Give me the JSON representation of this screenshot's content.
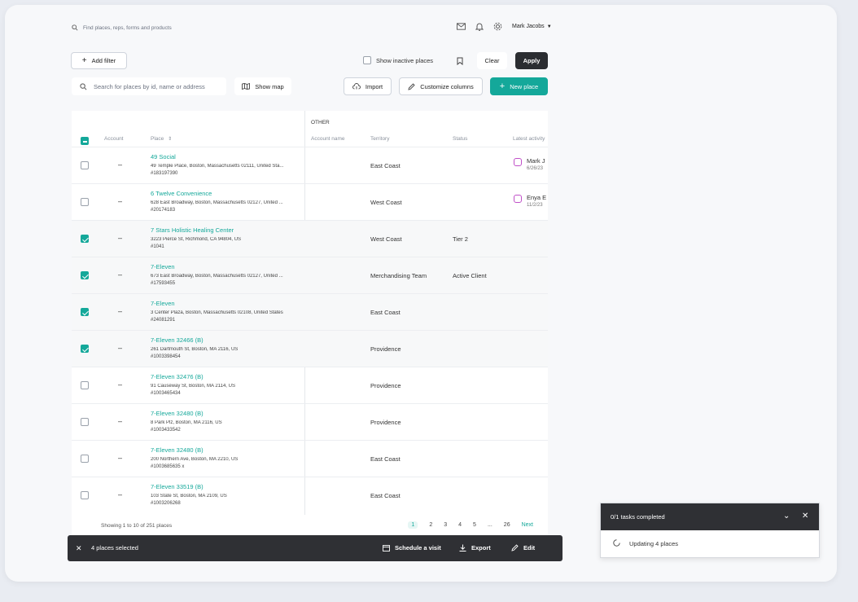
{
  "top": {
    "search_placeholder": "Find places, reps, forms and products",
    "user_name": "Mark Jacobs"
  },
  "filters": {
    "add_filter": "Add filter",
    "show_inactive": "Show inactive places",
    "clear": "Clear",
    "apply": "Apply"
  },
  "toolbar": {
    "search_placeholder": "Search for places by id, name or address",
    "show_map": "Show map",
    "import": "Import",
    "customize_columns": "Customize columns",
    "new_place": "New place"
  },
  "table": {
    "group_header": "OTHER",
    "headers": {
      "account": "Account",
      "place": "Place",
      "account_name": "Account name",
      "territory": "Territory",
      "status": "Status",
      "latest_activity": "Latest activity"
    },
    "rows": [
      {
        "selected": false,
        "account": "–",
        "name": "49 Social",
        "address": "49 Temple Place, Boston, Massachusetts 02111, United Sta...",
        "id": "#183197390",
        "territory": "East Coast",
        "status": "",
        "activity_name": "Mark J",
        "activity_date": "6/26/23"
      },
      {
        "selected": false,
        "account": "–",
        "name": "6 Twelve Convenience",
        "address": "628 East Broadway, Boston, Massachusetts 02127, United ...",
        "id": "#20174183",
        "territory": "West Coast",
        "status": "",
        "activity_name": "Enya E",
        "activity_date": "11/2/23"
      },
      {
        "selected": true,
        "account": "–",
        "name": "7 Stars Holistic Healing Center",
        "address": "3223 Pierce St, Richmond, CA 94804, US",
        "id": "#1041",
        "territory": "West Coast",
        "status": "Tier 2",
        "activity_name": "",
        "activity_date": ""
      },
      {
        "selected": true,
        "account": "–",
        "name": "7-Eleven",
        "address": "673 East Broadway, Boston, Massachusetts 02127, United ...",
        "id": "#17593455",
        "territory": "Merchandising Team",
        "status": "Active Client",
        "activity_name": "",
        "activity_date": ""
      },
      {
        "selected": true,
        "account": "–",
        "name": "7-Eleven",
        "address": "3 Center Plaza, Boston, Massachusetts 02108, United States",
        "id": "#24081291",
        "territory": "East Coast",
        "status": "",
        "activity_name": "",
        "activity_date": ""
      },
      {
        "selected": true,
        "account": "–",
        "name": "7-Eleven 32466 (B)",
        "address": "261 Dartmouth St, Boston, MA 2116, US",
        "id": "#1003398454",
        "territory": "Providence",
        "status": "",
        "activity_name": "",
        "activity_date": ""
      },
      {
        "selected": false,
        "account": "–",
        "name": "7-Eleven 32476 (B)",
        "address": "91 Causeway St, Boston, MA 2114, US",
        "id": "#1003465434",
        "territory": "Providence",
        "status": "",
        "activity_name": "",
        "activity_date": ""
      },
      {
        "selected": false,
        "account": "–",
        "name": "7-Eleven 32480 (B)",
        "address": "8 Park Plz, Boston, MA 2116, US",
        "id": "#1003433542",
        "territory": "Providence",
        "status": "",
        "activity_name": "",
        "activity_date": ""
      },
      {
        "selected": false,
        "account": "–",
        "name": "7-Eleven 32480 (B)",
        "address": "200 Northern Ave, Boston, MA 2210, US",
        "id": "#1003685635 x",
        "territory": "East Coast",
        "status": "",
        "activity_name": "",
        "activity_date": ""
      },
      {
        "selected": false,
        "account": "–",
        "name": "7-Eleven 33519 (B)",
        "address": "103 State St, Boston, MA 2109, US",
        "id": "#1003206268",
        "territory": "East Coast",
        "status": "",
        "activity_name": "",
        "activity_date": ""
      }
    ],
    "showing": "Showing 1 to 10 of 251 places",
    "pages": [
      "1",
      "2",
      "3",
      "4",
      "5",
      "...",
      "26"
    ],
    "next": "Next"
  },
  "selection_bar": {
    "count_label": "4 places selected",
    "schedule": "Schedule a visit",
    "export": "Export",
    "edit": "Edit"
  },
  "toast": {
    "title": "0/1 tasks completed",
    "task": "Updating 4 places"
  },
  "colors": {
    "accent": "#14a89a",
    "dark": "#2f3034",
    "activity_icon": "#c050c8"
  }
}
